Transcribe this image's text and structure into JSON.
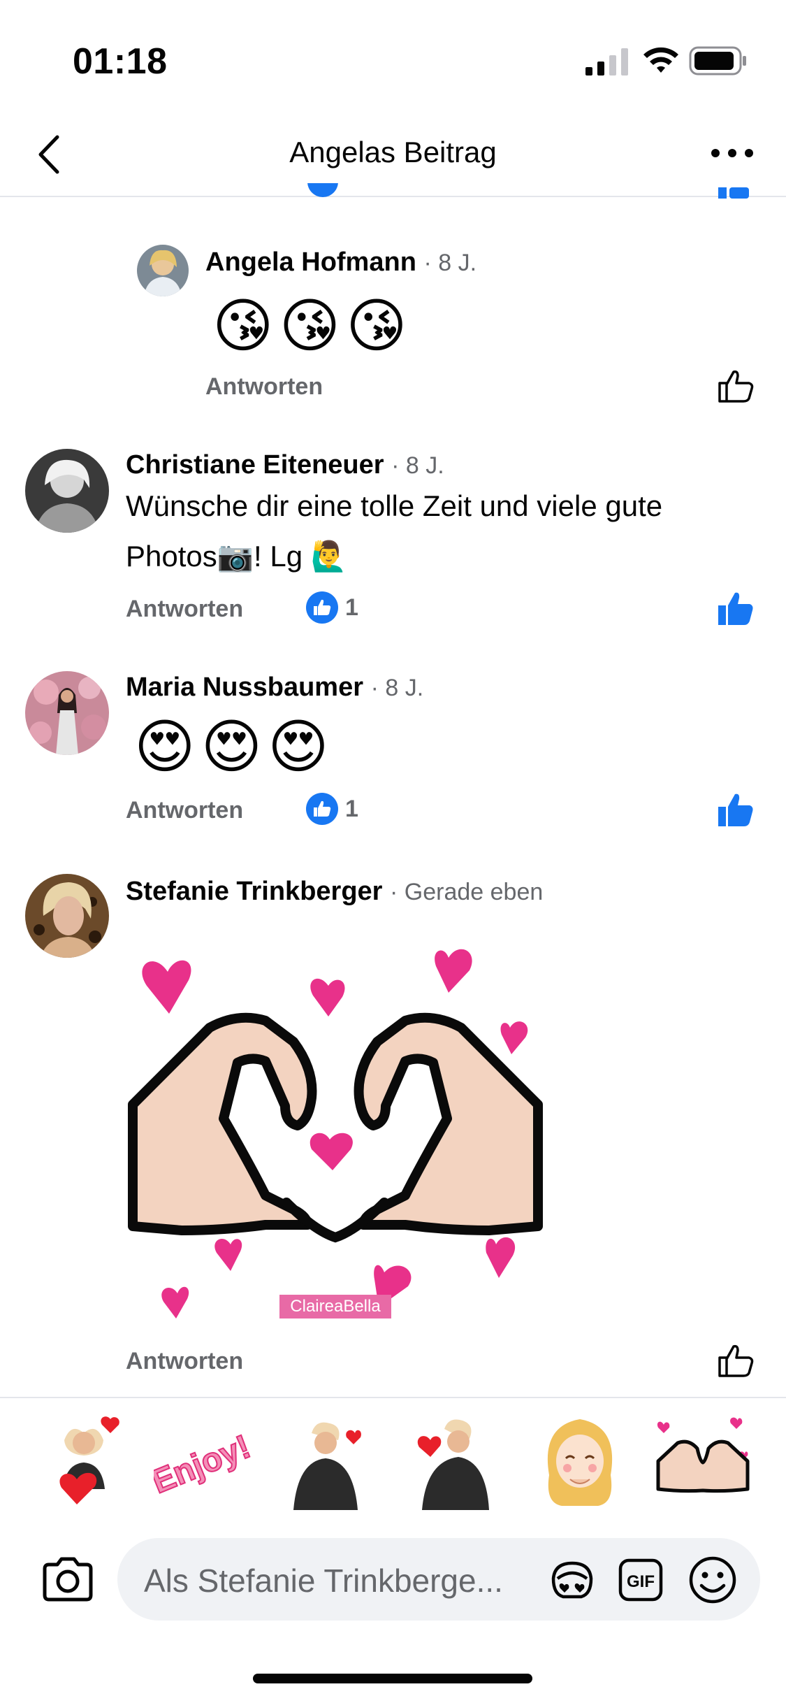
{
  "status_bar": {
    "time": "01:18"
  },
  "nav": {
    "title": "Angelas Beitrag"
  },
  "comments": [
    {
      "author": "Angela Hofmann",
      "meta": "· 8 J.",
      "emojis": [
        "😘",
        "😘",
        "😘"
      ],
      "reply": "Antworten",
      "liked": false
    },
    {
      "author": "Christiane Eiteneuer",
      "meta": "· 8 J.",
      "text_line1": "Wünsche dir eine tolle Zeit und viele gute",
      "text_line2": "Photos📷! Lg 🙋‍♂️",
      "reply": "Antworten",
      "reaction_count": "1",
      "liked": true
    },
    {
      "author": "Maria Nussbaumer",
      "meta": "· 8 J.",
      "emojis": [
        "😍",
        "😍",
        "😍"
      ],
      "reply": "Antworten",
      "reaction_count": "1",
      "liked": true
    },
    {
      "author": "Stefanie Trinkberger",
      "meta": "· Gerade eben",
      "sticker_watermark": "ClaireaBella",
      "reply": "Antworten",
      "liked": false
    }
  ],
  "stickers": [
    "sticker-avatar-hearts",
    "sticker-enjoy",
    "sticker-avatar-heart-wave",
    "sticker-avatar-heart-hands",
    "sticker-blonde-girl",
    "sticker-heart-hands"
  ],
  "composer": {
    "placeholder": "Als Stefanie Trinkberge..."
  },
  "colors": {
    "accent": "#1877f2",
    "muted": "#65676b",
    "pink": "#e8318a"
  }
}
